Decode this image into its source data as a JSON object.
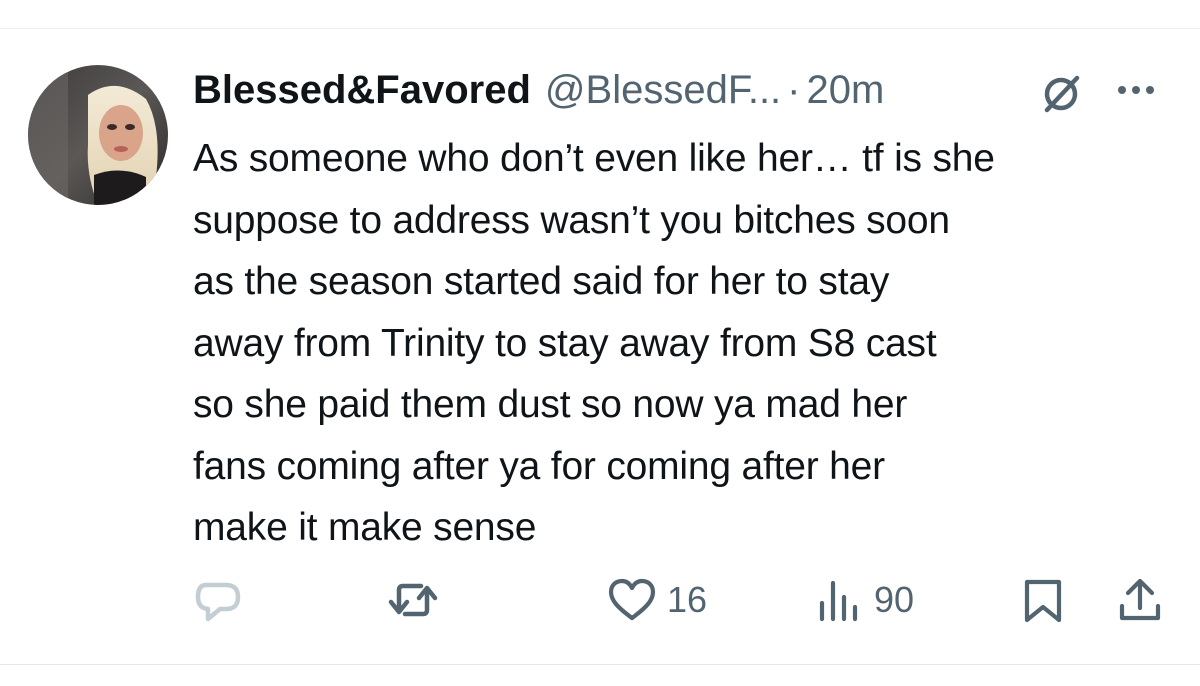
{
  "tweet": {
    "author": {
      "display_name": "Blessed&Favored",
      "handle": "@BlessedF...",
      "avatar_icon": "profile-photo"
    },
    "separator": "·",
    "time": "20m",
    "lines": [
      "As someone who don’t even like her… tf is she",
      "suppose to address wasn’t you bitches soon",
      "as the season started said for her to stay",
      "away from Trinity to stay away from S8 cast",
      "so she paid them dust so now ya mad her",
      "fans coming after ya for coming after her",
      "make it make sense"
    ]
  },
  "header_icons": [
    "grok-icon",
    "more-icon"
  ],
  "actions": {
    "reply": {
      "icon": "reply-icon"
    },
    "repost": {
      "icon": "repost-icon"
    },
    "like": {
      "icon": "heart-icon",
      "count": "16"
    },
    "views": {
      "icon": "views-icon",
      "count": "90"
    },
    "bookmark": {
      "icon": "bookmark-icon"
    },
    "share": {
      "icon": "share-icon"
    }
  },
  "colors": {
    "text": "#0f1419",
    "secondary": "#536471",
    "reply_icon": "#c3cdd4",
    "divider": "#eceff1"
  }
}
